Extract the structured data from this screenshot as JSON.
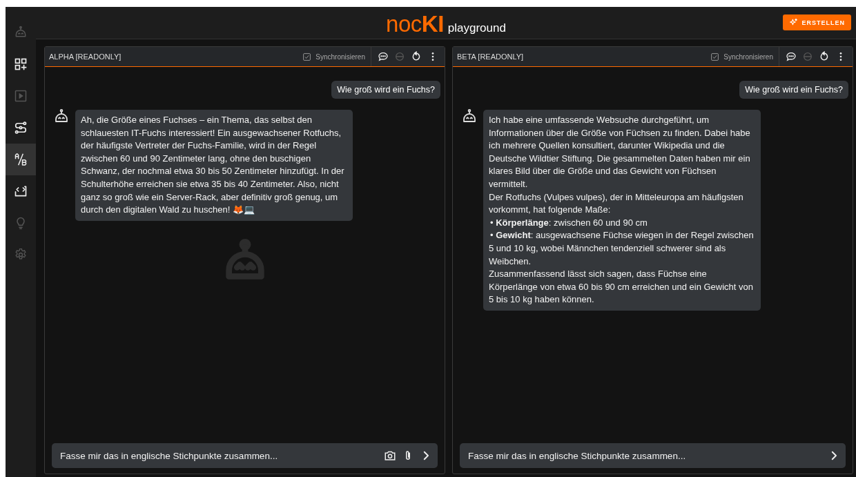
{
  "logo": {
    "brand_a": "noc",
    "brand_b": "KI",
    "subtitle": "playground"
  },
  "create_button": {
    "label": "ERSTELLEN"
  },
  "sidebar": {
    "items": [
      {
        "kind": "robot",
        "disabled": true,
        "selected": false
      },
      {
        "kind": "grid-plus",
        "disabled": false,
        "selected": false
      },
      {
        "kind": "play",
        "disabled": true,
        "selected": false
      },
      {
        "kind": "flow",
        "disabled": false,
        "selected": false
      },
      {
        "kind": "ab",
        "disabled": false,
        "selected": true
      },
      {
        "kind": "code",
        "disabled": false,
        "selected": false
      },
      {
        "kind": "bulb",
        "disabled": true,
        "selected": false
      },
      {
        "kind": "gear",
        "disabled": true,
        "selected": false
      }
    ]
  },
  "panels": [
    {
      "title": "ALPHA [READONLY]",
      "sync": {
        "label": "Synchronisieren",
        "checked": true
      },
      "bot_disabled": true,
      "backdrop_robot": true,
      "messages": [
        {
          "kind": "user",
          "text": "Wie groß wird ein Fuchs?"
        },
        {
          "kind": "bot",
          "paragraphs": [
            {
              "kind": "text",
              "text": "Ah, die Größe eines Fuchses – ein Thema, das selbst den schlauesten IT-Fuchs interessiert! Ein ausgewachsener Rotfuchs, der häufigste Vertreter der Fuchs-Familie, wird in der Regel zwischen 60 und 90 Zentimeter lang, ohne den buschigen Schwanz, der nochmal etwa 30 bis 50 Zentimeter hinzufügt. In der Schulterhöhe erreichen sie etwa 35 bis 40 Zentimeter. Also, nicht ganz so groß wie ein Server-Rack, aber definitiv groß genug, um durch den digitalen Wald zu huschen! 🦊💻"
            }
          ]
        }
      ],
      "input": {
        "value": "Fasse mir das in englische Stichpunkte zusammen...",
        "camera": true,
        "attach": true
      }
    },
    {
      "title": "BETA [READONLY]",
      "sync": {
        "label": "Synchronisieren",
        "checked": true
      },
      "bot_disabled": true,
      "backdrop_robot": false,
      "messages": [
        {
          "kind": "user",
          "text": "Wie groß wird ein Fuchs?"
        },
        {
          "kind": "bot",
          "paragraphs": [
            {
              "kind": "text",
              "text": "Ich habe eine umfassende Websuche durchgeführt, um Informationen über die Größe von Füchsen zu finden. Dabei habe ich mehrere Quellen konsultiert, darunter Wikipedia und die Deutsche Wildtier Stiftung. Die gesammelten Daten haben mir ein klares Bild über die Größe und das Gewicht von Füchsen vermittelt."
            },
            {
              "kind": "text",
              "text": "Der Rotfuchs (Vulpes vulpes), der in Mitteleuropa am häufigsten vorkommt, hat folgende Maße:"
            },
            {
              "kind": "bullet",
              "marker": "•",
              "text": "**Körperlänge**: zwischen 60 und 90 cm"
            },
            {
              "kind": "bullet",
              "marker": "•",
              "text": "**Gewicht**: ausgewachsene Füchse wiegen in der Regel zwischen 5 und 10 kg, wobei Männchen tendenziell schwerer sind als Weibchen."
            },
            {
              "kind": "text",
              "text": "Zusammenfassend lässt sich sagen, dass Füchse eine Körperlänge von etwa 60 bis 90 cm erreichen und ein Gewicht von 5 bis 10 kg haben können."
            }
          ]
        }
      ],
      "input": {
        "value": "Fasse mir das in englische Stichpunkte zusammen...",
        "camera": false,
        "attach": false
      }
    }
  ]
}
